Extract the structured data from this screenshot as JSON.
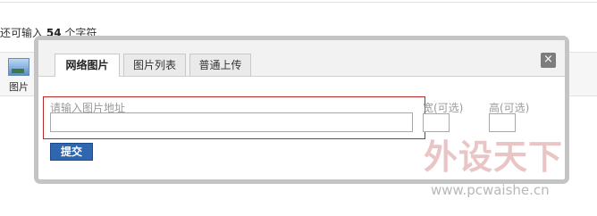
{
  "background": {
    "counter_prefix": "还可输入",
    "counter_number": "54",
    "counter_suffix": "个字符",
    "image_tool_label": "图片"
  },
  "dialog": {
    "tabs": [
      {
        "label": "网络图片",
        "active": true
      },
      {
        "label": "图片列表",
        "active": false
      },
      {
        "label": "普通上传",
        "active": false
      }
    ],
    "close_symbol": "×",
    "url_label": "请输入图片地址",
    "url_value": "",
    "width_label": "宽(可选)",
    "width_value": "",
    "height_label": "高(可选)",
    "height_value": "",
    "submit_label": "提交"
  },
  "watermark": {
    "brand_text": "外设天下",
    "site_text": "www.pcwaishe.cn"
  },
  "colors": {
    "highlight_border": "#b52828",
    "submit_button": "#2f66b0",
    "dialog_frame": "#c4c4c4"
  }
}
